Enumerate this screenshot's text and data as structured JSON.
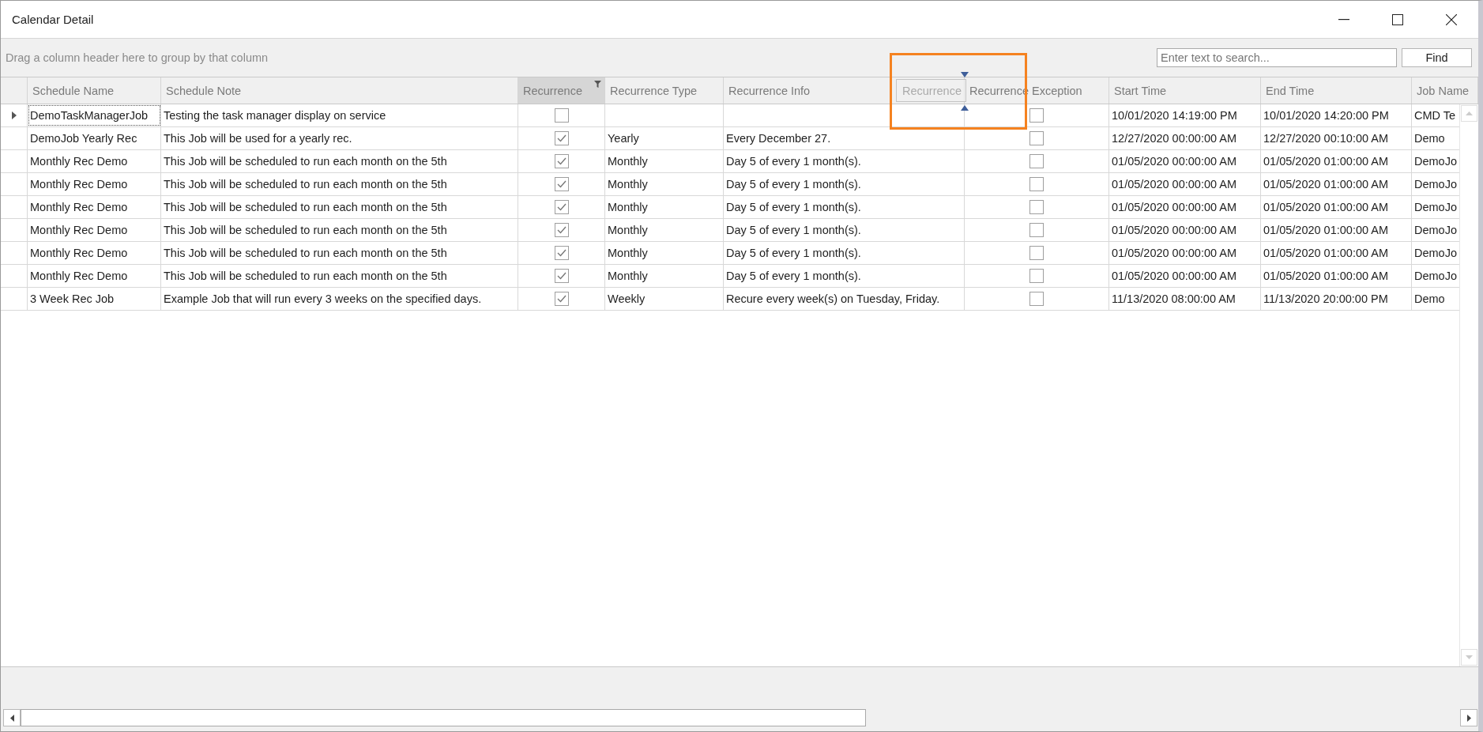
{
  "window": {
    "title": "Calendar Detail"
  },
  "group_panel": {
    "hint": "Drag a column header here to group by that column"
  },
  "search": {
    "placeholder": "Enter text to search..."
  },
  "find_button": {
    "label": "Find"
  },
  "columns": [
    {
      "label": "Schedule Name",
      "kind": "text",
      "filtered": false
    },
    {
      "label": "Schedule Note",
      "kind": "text",
      "filtered": false
    },
    {
      "label": "Recurrence",
      "kind": "check",
      "filtered": true
    },
    {
      "label": "Recurrence Type",
      "kind": "text",
      "filtered": false
    },
    {
      "label": "Recurrence Info",
      "kind": "text",
      "filtered": false
    },
    {
      "label": "Recurrence Exception",
      "kind": "check",
      "filtered": false
    },
    {
      "label": "Start Time",
      "kind": "text",
      "filtered": false
    },
    {
      "label": "End Time",
      "kind": "text",
      "filtered": false
    },
    {
      "label": "Job Name",
      "kind": "text",
      "filtered": false
    }
  ],
  "drag_header": {
    "label": "Recurrence"
  },
  "rows": [
    {
      "selected": true,
      "cells": [
        {
          "text": "DemoTaskManagerJob"
        },
        {
          "text": "Testing the task manager display on service"
        },
        {
          "checked": false
        },
        {},
        {},
        {
          "checked": false
        },
        {
          "text": "10/01/2020 14:19:00 PM"
        },
        {
          "text": "10/01/2020 14:20:00 PM"
        },
        {
          "text": "CMD Te"
        }
      ]
    },
    {
      "selected": false,
      "cells": [
        {
          "text": "DemoJob Yearly Rec"
        },
        {
          "text": "This Job will be used for a yearly rec."
        },
        {
          "checked": true
        },
        {
          "text": "Yearly"
        },
        {
          "text": "Every December 27."
        },
        {
          "checked": false
        },
        {
          "text": "12/27/2020 00:00:00 AM"
        },
        {
          "text": "12/27/2020 00:10:00 AM"
        },
        {
          "text": "Demo"
        }
      ]
    },
    {
      "selected": false,
      "cells": [
        {
          "text": "Monthly Rec Demo"
        },
        {
          "text": "This Job will be scheduled to run each month on the 5th"
        },
        {
          "checked": true
        },
        {
          "text": "Monthly"
        },
        {
          "text": "Day 5 of every 1 month(s)."
        },
        {
          "checked": false
        },
        {
          "text": "01/05/2020 00:00:00 AM"
        },
        {
          "text": "01/05/2020 01:00:00 AM"
        },
        {
          "text": "DemoJo"
        }
      ]
    },
    {
      "selected": false,
      "cells": [
        {
          "text": "Monthly Rec Demo"
        },
        {
          "text": "This Job will be scheduled to run each month on the 5th"
        },
        {
          "checked": true
        },
        {
          "text": "Monthly"
        },
        {
          "text": "Day 5 of every 1 month(s)."
        },
        {
          "checked": false
        },
        {
          "text": "01/05/2020 00:00:00 AM"
        },
        {
          "text": "01/05/2020 01:00:00 AM"
        },
        {
          "text": "DemoJo"
        }
      ]
    },
    {
      "selected": false,
      "cells": [
        {
          "text": "Monthly Rec Demo"
        },
        {
          "text": "This Job will be scheduled to run each month on the 5th"
        },
        {
          "checked": true
        },
        {
          "text": "Monthly"
        },
        {
          "text": "Day 5 of every 1 month(s)."
        },
        {
          "checked": false
        },
        {
          "text": "01/05/2020 00:00:00 AM"
        },
        {
          "text": "01/05/2020 01:00:00 AM"
        },
        {
          "text": "DemoJo"
        }
      ]
    },
    {
      "selected": false,
      "cells": [
        {
          "text": "Monthly Rec Demo"
        },
        {
          "text": "This Job will be scheduled to run each month on the 5th"
        },
        {
          "checked": true
        },
        {
          "text": "Monthly"
        },
        {
          "text": "Day 5 of every 1 month(s)."
        },
        {
          "checked": false
        },
        {
          "text": "01/05/2020 00:00:00 AM"
        },
        {
          "text": "01/05/2020 01:00:00 AM"
        },
        {
          "text": "DemoJo"
        }
      ]
    },
    {
      "selected": false,
      "cells": [
        {
          "text": "Monthly Rec Demo"
        },
        {
          "text": "This Job will be scheduled to run each month on the 5th"
        },
        {
          "checked": true
        },
        {
          "text": "Monthly"
        },
        {
          "text": "Day 5 of every 1 month(s)."
        },
        {
          "checked": false
        },
        {
          "text": "01/05/2020 00:00:00 AM"
        },
        {
          "text": "01/05/2020 01:00:00 AM"
        },
        {
          "text": "DemoJo"
        }
      ]
    },
    {
      "selected": false,
      "cells": [
        {
          "text": "Monthly Rec Demo"
        },
        {
          "text": "This Job will be scheduled to run each month on the 5th"
        },
        {
          "checked": true
        },
        {
          "text": "Monthly"
        },
        {
          "text": "Day 5 of every 1 month(s)."
        },
        {
          "checked": false
        },
        {
          "text": "01/05/2020 00:00:00 AM"
        },
        {
          "text": "01/05/2020 01:00:00 AM"
        },
        {
          "text": "DemoJo"
        }
      ]
    },
    {
      "selected": false,
      "cells": [
        {
          "text": "3 Week Rec Job"
        },
        {
          "text": "Example Job that will run every 3 weeks on the specified days."
        },
        {
          "checked": true
        },
        {
          "text": "Weekly"
        },
        {
          "text": "Recure every week(s) on Tuesday, Friday."
        },
        {
          "checked": false
        },
        {
          "text": "11/13/2020 08:00:00 AM"
        },
        {
          "text": "11/13/2020 20:00:00 PM"
        },
        {
          "text": "Demo"
        }
      ]
    }
  ]
}
